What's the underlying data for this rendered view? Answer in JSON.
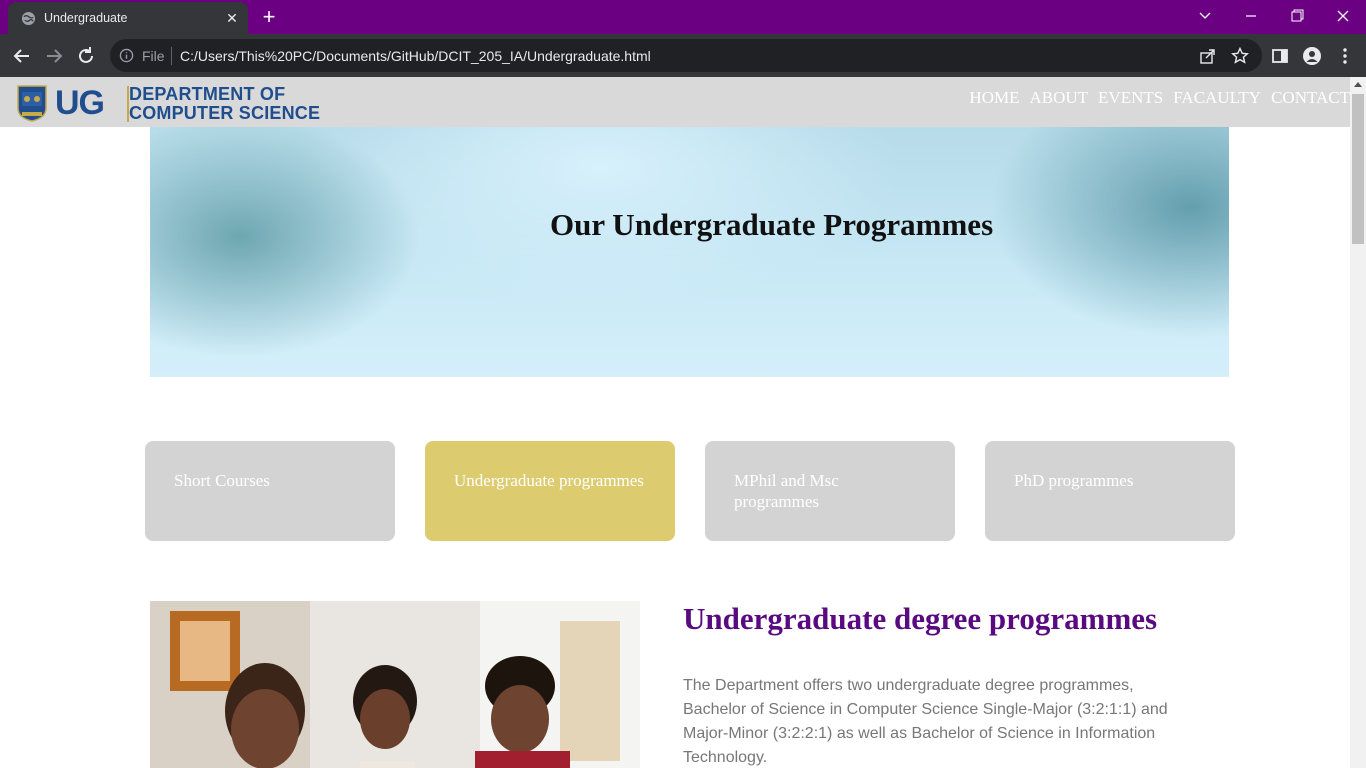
{
  "browser": {
    "tab_title": "Undergraduate",
    "address_scheme": "File",
    "url": "C:/Users/This%20PC/Documents/GitHub/DCIT_205_IA/Undergraduate.html"
  },
  "header": {
    "logo_mark": "UG",
    "logo_line1": "DEPARTMENT OF",
    "logo_line2": "COMPUTER SCIENCE",
    "nav": [
      "HOME",
      "ABOUT",
      "EVENTS",
      "FACAULTY",
      "CONTACT"
    ]
  },
  "hero": {
    "title": "Our Undergraduate Programmes"
  },
  "cards": [
    {
      "label": "Short Courses",
      "active": false
    },
    {
      "label": "Undergraduate programmes",
      "active": true
    },
    {
      "label": "MPhil and Msc programmes",
      "active": false
    },
    {
      "label": "PhD programmes",
      "active": false
    }
  ],
  "section": {
    "title": "Undergraduate degree programmes",
    "body": "The Department offers two undergraduate degree programmes, Bachelor of Science in Computer Science Single-Major (3:2:1:1) and Major-Minor (3:2:2:1) as well as Bachelor of Science in Information Technology."
  },
  "colors": {
    "tabbar": "#6b0082",
    "active_card": "#dccb6f",
    "inactive_card": "#d3d3d3",
    "section_title": "#5a0a80",
    "logo_blue": "#1f4d8e"
  },
  "icons": [
    "globe-icon",
    "close-icon",
    "plus-icon",
    "chevron-down-icon",
    "minimize-icon",
    "restore-icon",
    "window-close-icon",
    "back-icon",
    "forward-icon",
    "reload-icon",
    "info-icon",
    "share-icon",
    "star-icon",
    "sidebar-icon",
    "profile-icon",
    "menu-icon"
  ]
}
